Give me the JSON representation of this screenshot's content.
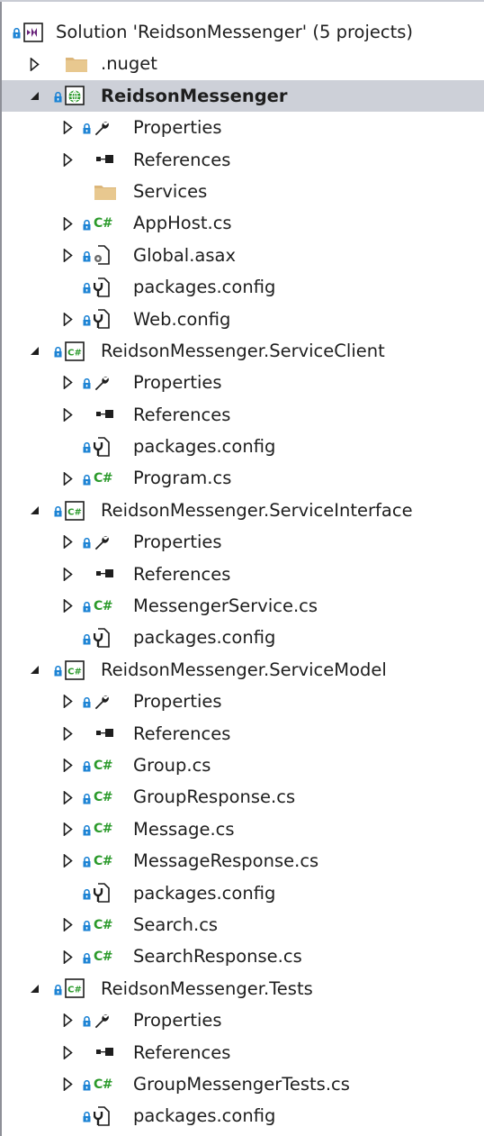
{
  "solution_explorer": {
    "items": [
      {
        "label": "Solution 'ReidsonMessenger' (5 projects)",
        "icon": "solution-icon",
        "expander": "none",
        "level": 0,
        "locked": true
      },
      {
        "label": ".nuget",
        "icon": "folder-icon",
        "expander": "collapsed",
        "level": 1,
        "locked": false
      },
      {
        "label": "ReidsonMessenger",
        "icon": "web-project-icon",
        "expander": "expanded",
        "level": 1,
        "locked": true,
        "selected": true
      },
      {
        "label": "Properties",
        "icon": "wrench-icon",
        "expander": "collapsed",
        "level": 2,
        "locked": true
      },
      {
        "label": "References",
        "icon": "references-icon",
        "expander": "collapsed",
        "level": 2,
        "locked": false
      },
      {
        "label": "Services",
        "icon": "folder-icon",
        "expander": "none",
        "level": 2,
        "locked": false
      },
      {
        "label": "AppHost.cs",
        "icon": "csharp-file-icon",
        "expander": "collapsed",
        "level": 2,
        "locked": true
      },
      {
        "label": "Global.asax",
        "icon": "asax-file-icon",
        "expander": "collapsed",
        "level": 2,
        "locked": true
      },
      {
        "label": "packages.config",
        "icon": "config-file-icon",
        "expander": "none",
        "level": 2,
        "locked": true
      },
      {
        "label": "Web.config",
        "icon": "config-file-icon",
        "expander": "collapsed",
        "level": 2,
        "locked": true
      },
      {
        "label": "ReidsonMessenger.ServiceClient",
        "icon": "csharp-project-icon",
        "expander": "expanded",
        "level": 1,
        "locked": true
      },
      {
        "label": "Properties",
        "icon": "wrench-icon",
        "expander": "collapsed",
        "level": 2,
        "locked": true
      },
      {
        "label": "References",
        "icon": "references-icon",
        "expander": "collapsed",
        "level": 2,
        "locked": false
      },
      {
        "label": "packages.config",
        "icon": "config-file-icon",
        "expander": "none",
        "level": 2,
        "locked": true
      },
      {
        "label": "Program.cs",
        "icon": "csharp-file-icon",
        "expander": "collapsed",
        "level": 2,
        "locked": true
      },
      {
        "label": "ReidsonMessenger.ServiceInterface",
        "icon": "csharp-project-icon",
        "expander": "expanded",
        "level": 1,
        "locked": true
      },
      {
        "label": "Properties",
        "icon": "wrench-icon",
        "expander": "collapsed",
        "level": 2,
        "locked": true
      },
      {
        "label": "References",
        "icon": "references-icon",
        "expander": "collapsed",
        "level": 2,
        "locked": false
      },
      {
        "label": "MessengerService.cs",
        "icon": "csharp-file-icon",
        "expander": "collapsed",
        "level": 2,
        "locked": true
      },
      {
        "label": "packages.config",
        "icon": "config-file-icon",
        "expander": "none",
        "level": 2,
        "locked": true
      },
      {
        "label": "ReidsonMessenger.ServiceModel",
        "icon": "csharp-project-icon",
        "expander": "expanded",
        "level": 1,
        "locked": true
      },
      {
        "label": "Properties",
        "icon": "wrench-icon",
        "expander": "collapsed",
        "level": 2,
        "locked": true
      },
      {
        "label": "References",
        "icon": "references-icon",
        "expander": "collapsed",
        "level": 2,
        "locked": false
      },
      {
        "label": "Group.cs",
        "icon": "csharp-file-icon",
        "expander": "collapsed",
        "level": 2,
        "locked": true
      },
      {
        "label": "GroupResponse.cs",
        "icon": "csharp-file-icon",
        "expander": "collapsed",
        "level": 2,
        "locked": true
      },
      {
        "label": "Message.cs",
        "icon": "csharp-file-icon",
        "expander": "collapsed",
        "level": 2,
        "locked": true
      },
      {
        "label": "MessageResponse.cs",
        "icon": "csharp-file-icon",
        "expander": "collapsed",
        "level": 2,
        "locked": true
      },
      {
        "label": "packages.config",
        "icon": "config-file-icon",
        "expander": "none",
        "level": 2,
        "locked": true
      },
      {
        "label": "Search.cs",
        "icon": "csharp-file-icon",
        "expander": "collapsed",
        "level": 2,
        "locked": true
      },
      {
        "label": "SearchResponse.cs",
        "icon": "csharp-file-icon",
        "expander": "collapsed",
        "level": 2,
        "locked": true
      },
      {
        "label": "ReidsonMessenger.Tests",
        "icon": "csharp-project-icon",
        "expander": "expanded",
        "level": 1,
        "locked": true
      },
      {
        "label": "Properties",
        "icon": "wrench-icon",
        "expander": "collapsed",
        "level": 2,
        "locked": true
      },
      {
        "label": "References",
        "icon": "references-icon",
        "expander": "collapsed",
        "level": 2,
        "locked": false
      },
      {
        "label": "GroupMessengerTests.cs",
        "icon": "csharp-file-icon",
        "expander": "collapsed",
        "level": 2,
        "locked": true
      },
      {
        "label": "packages.config",
        "icon": "config-file-icon",
        "expander": "none",
        "level": 2,
        "locked": true
      }
    ]
  },
  "colors": {
    "selection_bg": "#cdd0d8",
    "lock_blue": "#1c83d4",
    "csharp_green": "#2b9a2b",
    "folder_tan": "#dcb67a",
    "text": "#1e1e1e"
  }
}
